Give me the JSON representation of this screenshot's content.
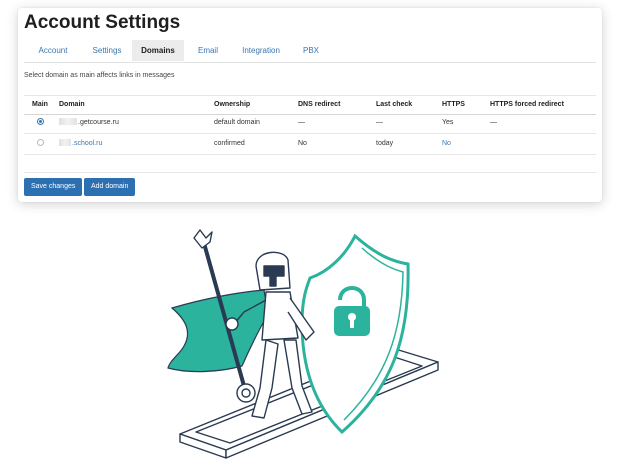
{
  "page": {
    "title": "Account Settings"
  },
  "tabs": [
    {
      "label": "Account",
      "active": false
    },
    {
      "label": "Settings",
      "active": false
    },
    {
      "label": "Domains",
      "active": true
    },
    {
      "label": "Email",
      "active": false
    },
    {
      "label": "Integration",
      "active": false
    },
    {
      "label": "PBX",
      "active": false
    }
  ],
  "hint": "Select domain as main affects links in messages",
  "table": {
    "columns": [
      "Main",
      "Domain",
      "Ownership",
      "DNS redirect",
      "Last check",
      "HTTPS",
      "HTTPS forced redirect"
    ],
    "rows": [
      {
        "main": true,
        "domain_suffix": ".getcourse.ru",
        "ownership": "default domain",
        "dns_redirect": "—",
        "last_check": "—",
        "https": "Yes",
        "https_forced": "—"
      },
      {
        "main": false,
        "domain_suffix": ".school.ru",
        "ownership": "confirmed",
        "dns_redirect": "No",
        "last_check": "today",
        "https": "No",
        "https_forced": ""
      }
    ]
  },
  "buttons": {
    "save": "Save changes",
    "add": "Add domain"
  },
  "colors": {
    "accent": "#2d70b2",
    "link": "#3a76b0",
    "illustration_teal": "#2bb39d",
    "ink": "#2a3a52"
  }
}
